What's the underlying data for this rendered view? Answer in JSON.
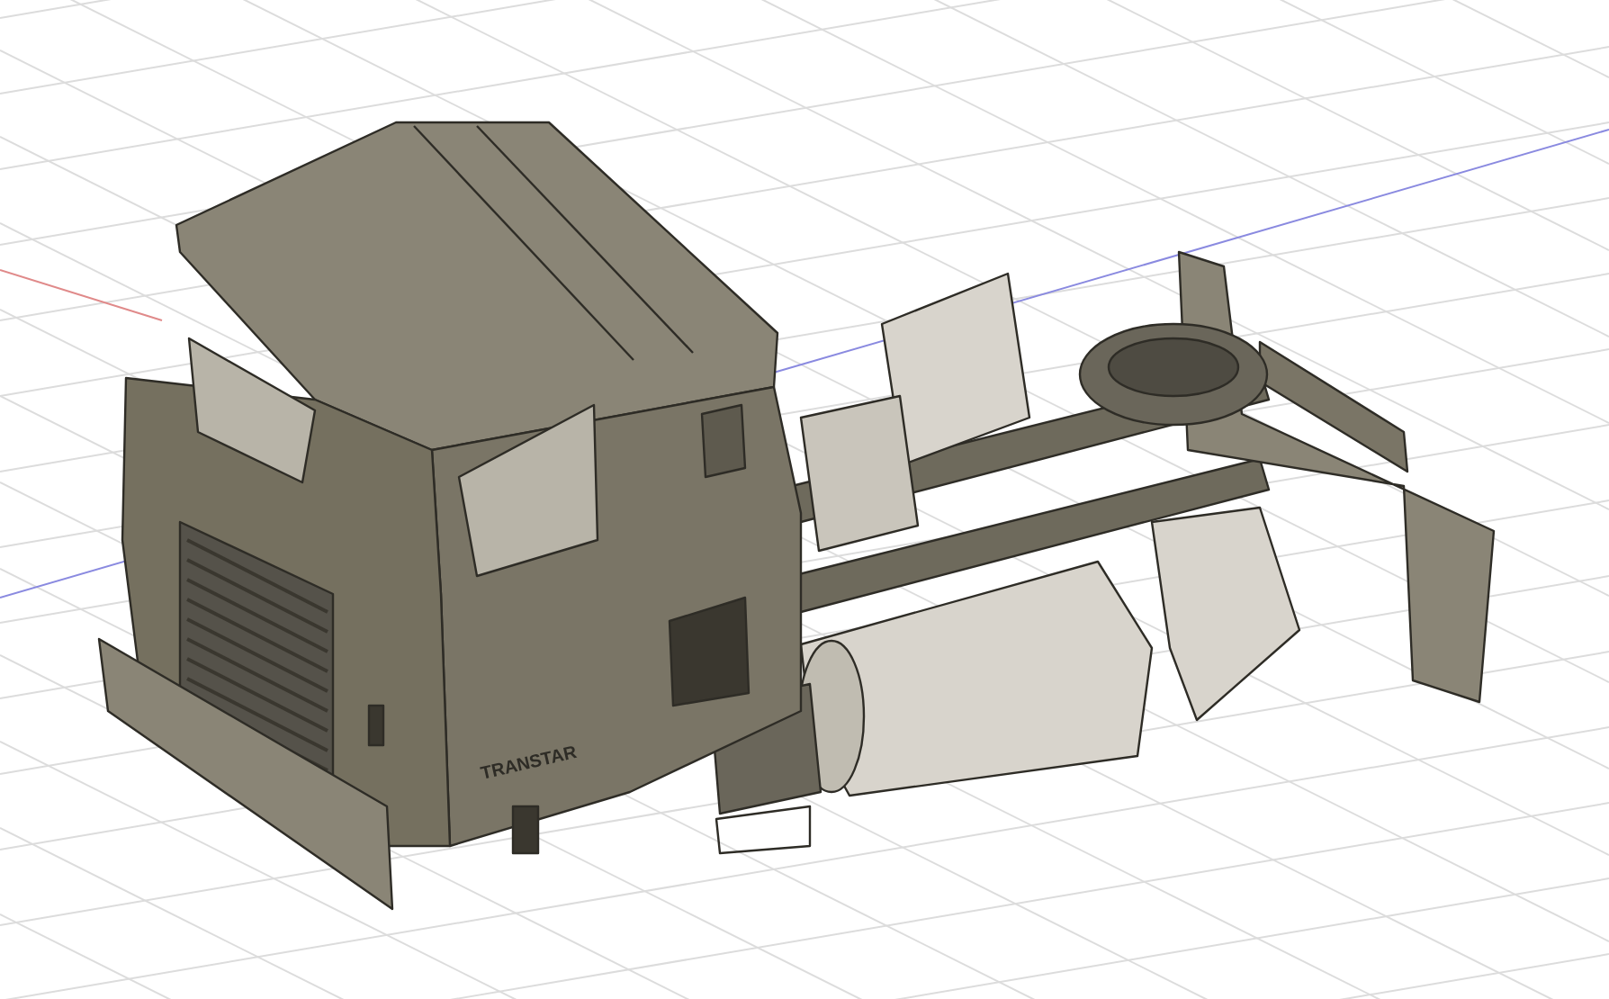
{
  "viewport": {
    "model_badge": "TRANSTAR"
  }
}
